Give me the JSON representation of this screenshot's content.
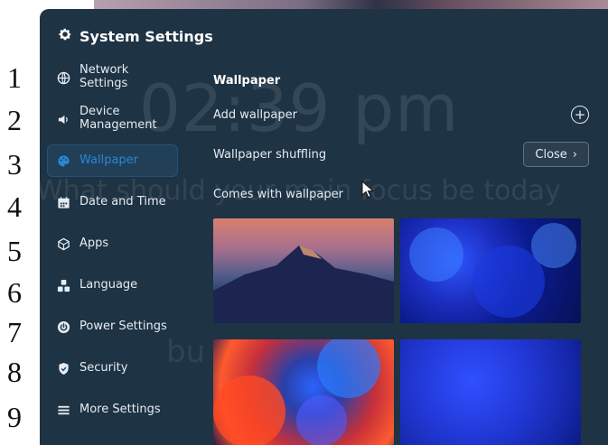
{
  "margin_numbers": [
    "1",
    "2",
    "3",
    "4",
    "5",
    "6",
    "7",
    "8",
    "9"
  ],
  "background": {
    "clock": "02:39 pm",
    "focus_text": "What should your main focus be today",
    "bottom_text": "bu"
  },
  "window": {
    "title": "System Settings"
  },
  "sidebar": {
    "items": [
      {
        "label": "Network Settings",
        "icon": "globe-icon"
      },
      {
        "label": "Device Management",
        "icon": "speaker-icon"
      },
      {
        "label": "Wallpaper",
        "icon": "palette-icon",
        "active": true
      },
      {
        "label": "Date and Time",
        "icon": "calendar-icon"
      },
      {
        "label": "Apps",
        "icon": "cube-icon"
      },
      {
        "label": "Language",
        "icon": "language-icon"
      },
      {
        "label": "Power Settings",
        "icon": "power-icon"
      },
      {
        "label": "Security",
        "icon": "shield-icon"
      },
      {
        "label": "More Settings",
        "icon": "menu-icon"
      }
    ]
  },
  "content": {
    "title": "Wallpaper",
    "add_wallpaper_label": "Add wallpaper",
    "shuffle_label": "Wallpaper shuffling",
    "shuffle_value": "Close",
    "builtin_label": "Comes with wallpaper"
  },
  "colors": {
    "window_bg": "#1e3344",
    "accent": "#2a87d6",
    "text": "#e6ecf1"
  }
}
